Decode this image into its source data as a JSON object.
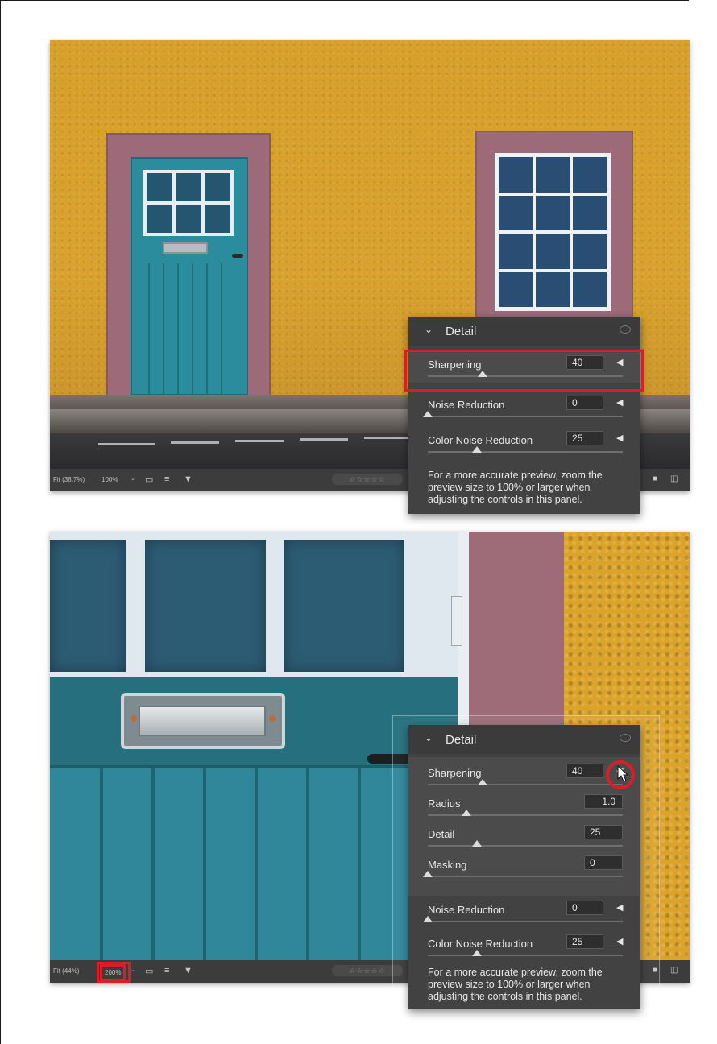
{
  "screens": [
    {
      "toolbar": {
        "fit_label": "Fit (38.7%)",
        "zoom_label": "100%",
        "zoom_caret": "⌄",
        "icons": [
          "filmstrip-icon",
          "sort-icon",
          "filter-icon"
        ],
        "rating_stars": "☆☆☆☆☆",
        "right_icons": [
          "single-view-icon",
          "compare-view-icon"
        ]
      },
      "panel": {
        "title": "Detail",
        "rows": [
          {
            "label": "Sharpening",
            "value": "40",
            "fraction": 0.28
          },
          {
            "label": "Noise Reduction",
            "value": "0",
            "fraction": 0.0
          },
          {
            "label": "Color Noise Reduction",
            "value": "25",
            "fraction": 0.25
          }
        ],
        "hint": "For a more accurate preview, zoom the preview size to 100% or larger when adjusting the controls in this panel."
      }
    },
    {
      "toolbar": {
        "fit_label": "Fit (44%)",
        "zoom_label": "200%",
        "zoom_caret": "⌄",
        "icons": [
          "filmstrip-icon",
          "sort-icon",
          "filter-icon"
        ],
        "rating_stars": "☆☆☆☆☆",
        "right_icons": [
          "single-view-icon",
          "compare-view-icon"
        ]
      },
      "panel": {
        "title": "Detail",
        "rows": [
          {
            "label": "Sharpening",
            "value": "40",
            "fraction": 0.28
          },
          {
            "label": "Radius",
            "value": "1.0",
            "fraction": 0.2
          },
          {
            "label": "Detail",
            "value": "25",
            "fraction": 0.25
          },
          {
            "label": "Masking",
            "value": "0",
            "fraction": 0.0
          },
          {
            "label": "Noise Reduction",
            "value": "0",
            "fraction": 0.0
          },
          {
            "label": "Color Noise Reduction",
            "value": "25",
            "fraction": 0.25
          }
        ],
        "hint": "For a more accurate preview, zoom the preview size to 100% or larger when adjusting the controls in this panel."
      }
    }
  ],
  "highlight_color": "#d71f28",
  "panel_bg": "#424242"
}
